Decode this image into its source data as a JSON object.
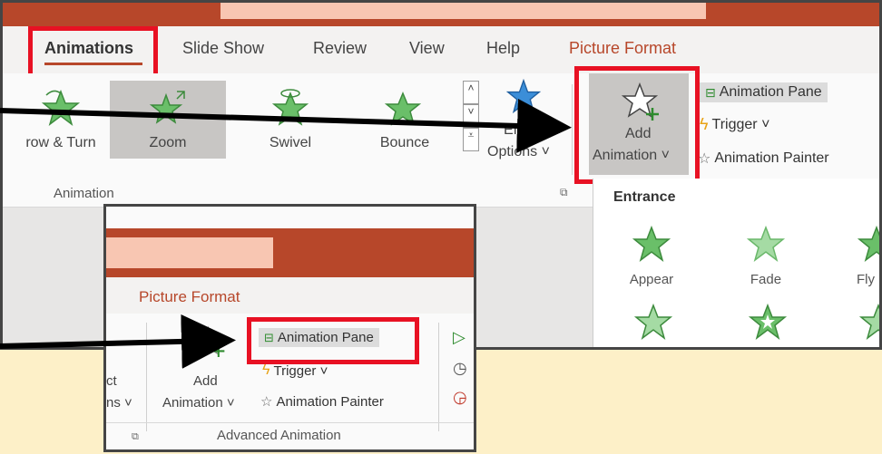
{
  "main": {
    "tabs": [
      {
        "label": "Animations",
        "active": true
      },
      {
        "label": "Slide Show"
      },
      {
        "label": "Review"
      },
      {
        "label": "View"
      },
      {
        "label": "Help"
      },
      {
        "label": "Picture Format",
        "contextual": true
      }
    ],
    "gallery": [
      {
        "label": "row & Turn",
        "icon": "grow-turn-star-icon"
      },
      {
        "label": "Zoom",
        "icon": "zoom-star-icon",
        "selected": true
      },
      {
        "label": "Swivel",
        "icon": "swivel-star-icon"
      },
      {
        "label": "Bounce",
        "icon": "bounce-star-icon"
      }
    ],
    "effect_options": {
      "line1": "Effect",
      "line2": "Options ˅"
    },
    "add_animation": {
      "line1": "Add",
      "line2": "Animation ˅"
    },
    "advanced": {
      "animation_pane": "Animation Pane",
      "trigger": "Trigger ˅",
      "animation_painter": "Animation Painter"
    },
    "group_label": "Animation",
    "dropdown": {
      "header": "Entrance",
      "items": [
        {
          "label": "Appear"
        },
        {
          "label": "Fade"
        },
        {
          "label": "Fly"
        }
      ]
    }
  },
  "inset": {
    "tab": "Picture Format",
    "left_partial": {
      "line1": "ct",
      "line2": "ns ˅"
    },
    "add_animation": {
      "line1": "Add",
      "line2": "Animation ˅"
    },
    "animation_pane": "Animation Pane",
    "trigger": "Trigger ˅",
    "animation_painter": "Animation Painter",
    "group_label": "Advanced Animation"
  },
  "colors": {
    "accent": "#b7472a",
    "highlight": "#e81123",
    "background": "#fdf0c8",
    "star_green": "#6abf69",
    "star_blue": "#3b8ed8"
  }
}
